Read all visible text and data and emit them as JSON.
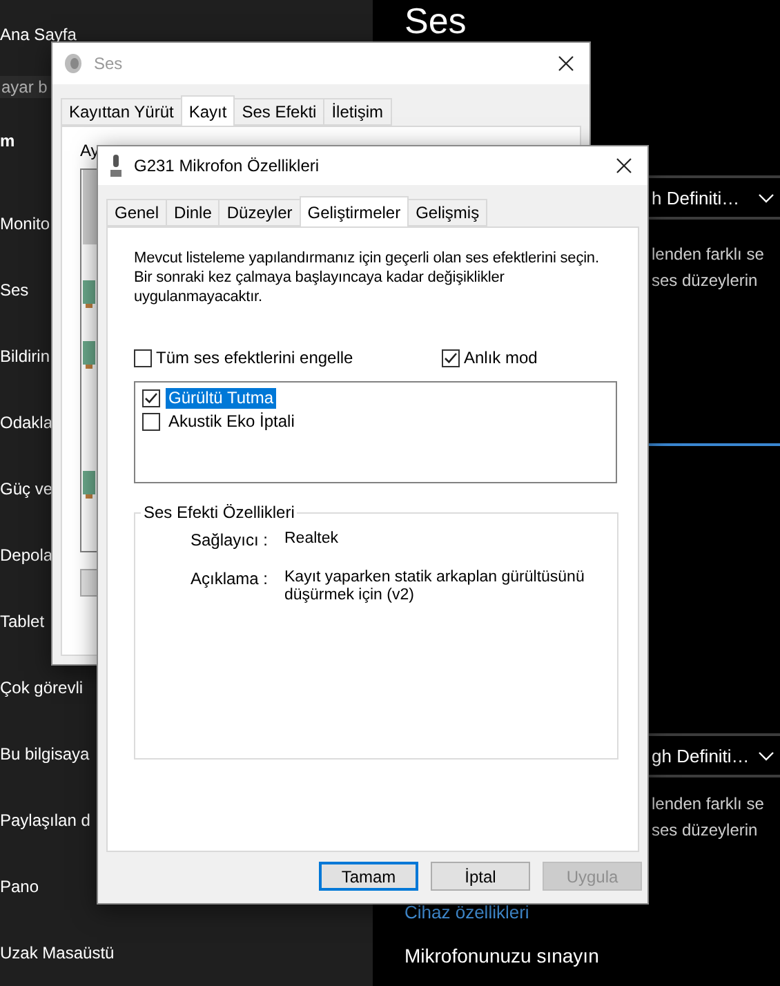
{
  "sidebar": {
    "home": "Ana Sayfa",
    "search": {
      "placeholder": "ayar b"
    },
    "section": "m",
    "items": [
      "Monito",
      "Ses",
      "Bildirin",
      "Odakla",
      "Güç ve",
      "Depola",
      "Tablet",
      "Çok görevli",
      "Bu bilgisaya",
      "Paylaşılan d",
      "Pano",
      "Uzak Masaüstü"
    ]
  },
  "main": {
    "title": "Ses",
    "devices": [
      {
        "dropdown": "h Definiti…",
        "description": [
          "lenden farklı se",
          "ses düzeylerin"
        ]
      },
      {
        "dropdown": "gh Definiti…",
        "description": [
          "lenden farklı se",
          "ses düzeylerin"
        ]
      }
    ],
    "link": "Cihaz özellikleri",
    "heading": "Mikrofonunuzu sınayın"
  },
  "sound_window": {
    "title": "Ses",
    "tabs": [
      {
        "label": "Kayıttan Yürüt",
        "selected": false
      },
      {
        "label": "Kayıt",
        "selected": true
      },
      {
        "label": "Ses Efekti",
        "selected": false
      },
      {
        "label": "İletişim",
        "selected": false
      }
    ],
    "intro": "Ay"
  },
  "dialog": {
    "title": "G231 Mikrofon Özellikleri",
    "tabs": [
      {
        "label": "Genel",
        "selected": false
      },
      {
        "label": "Dinle",
        "selected": false
      },
      {
        "label": "Düzeyler",
        "selected": false
      },
      {
        "label": "Geliştirmeler",
        "selected": true
      },
      {
        "label": "Gelişmiş",
        "selected": false
      }
    ],
    "instructions": "Mevcut listeleme yapılandırmanız için geçerli olan ses efektlerini seçin. Bir sonraki kez çalmaya başlayıncaya kadar değişiklikler uygulanmayacaktır.",
    "options": [
      {
        "label": "Tüm ses efektlerini engelle",
        "checked": false
      },
      {
        "label": "Anlık mod",
        "checked": true
      }
    ],
    "effects": [
      {
        "label": "Gürültü Tutma",
        "checked": true,
        "selected": true
      },
      {
        "label": "Akustik Eko İptali",
        "checked": false,
        "selected": false
      }
    ],
    "properties": {
      "title": "Ses Efekti Özellikleri",
      "rows": [
        {
          "label": "Sağlayıcı :",
          "value": "Realtek"
        },
        {
          "label": "Açıklama :",
          "value": "Kayıt yaparken statik arkaplan gürültüsünü düşürmek için (v2)"
        }
      ]
    },
    "buttons": [
      {
        "label": "Tamam",
        "default": true,
        "disabled": false
      },
      {
        "label": "İptal",
        "default": false,
        "disabled": false
      },
      {
        "label": "Uygula",
        "default": false,
        "disabled": true
      }
    ]
  }
}
